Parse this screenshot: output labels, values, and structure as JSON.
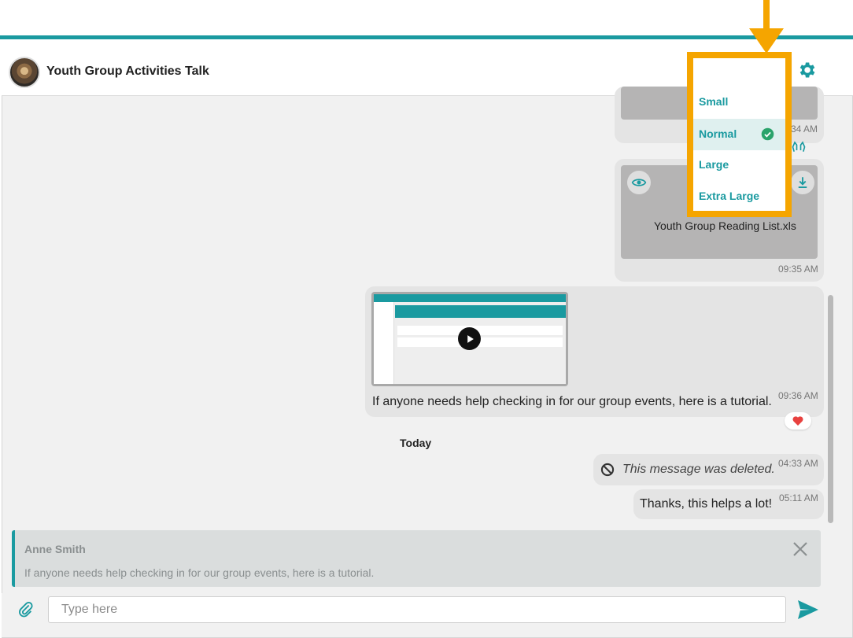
{
  "header": {
    "title": "Youth Group Activities Talk"
  },
  "font_menu": {
    "options": [
      "Small",
      "Normal",
      "Large",
      "Extra Large"
    ],
    "selected": "Normal"
  },
  "messages": {
    "m1_time_partial": "34 AM",
    "m2_filename": "Youth Group Reading List.xls",
    "m2_time": "09:35 AM",
    "m3_text": "If anyone needs help checking in for our group events, here is a tutorial.",
    "m3_time": "09:36 AM",
    "day_divider": "Today",
    "m4_text": "This message was deleted.",
    "m4_time": "04:33 AM",
    "m5_text": "Thanks, this helps a lot!",
    "m5_time": "05:11 AM"
  },
  "reply": {
    "name": "Anne Smith",
    "text": "If anyone needs help checking in for our group events, here is a tutorial."
  },
  "composer": {
    "placeholder": "Type here"
  },
  "colors": {
    "accent": "#1a9aa0",
    "highlight": "#f5a500",
    "bubble": "#e4e4e4",
    "heart": "#e8413f",
    "check": "#2aa36b"
  }
}
